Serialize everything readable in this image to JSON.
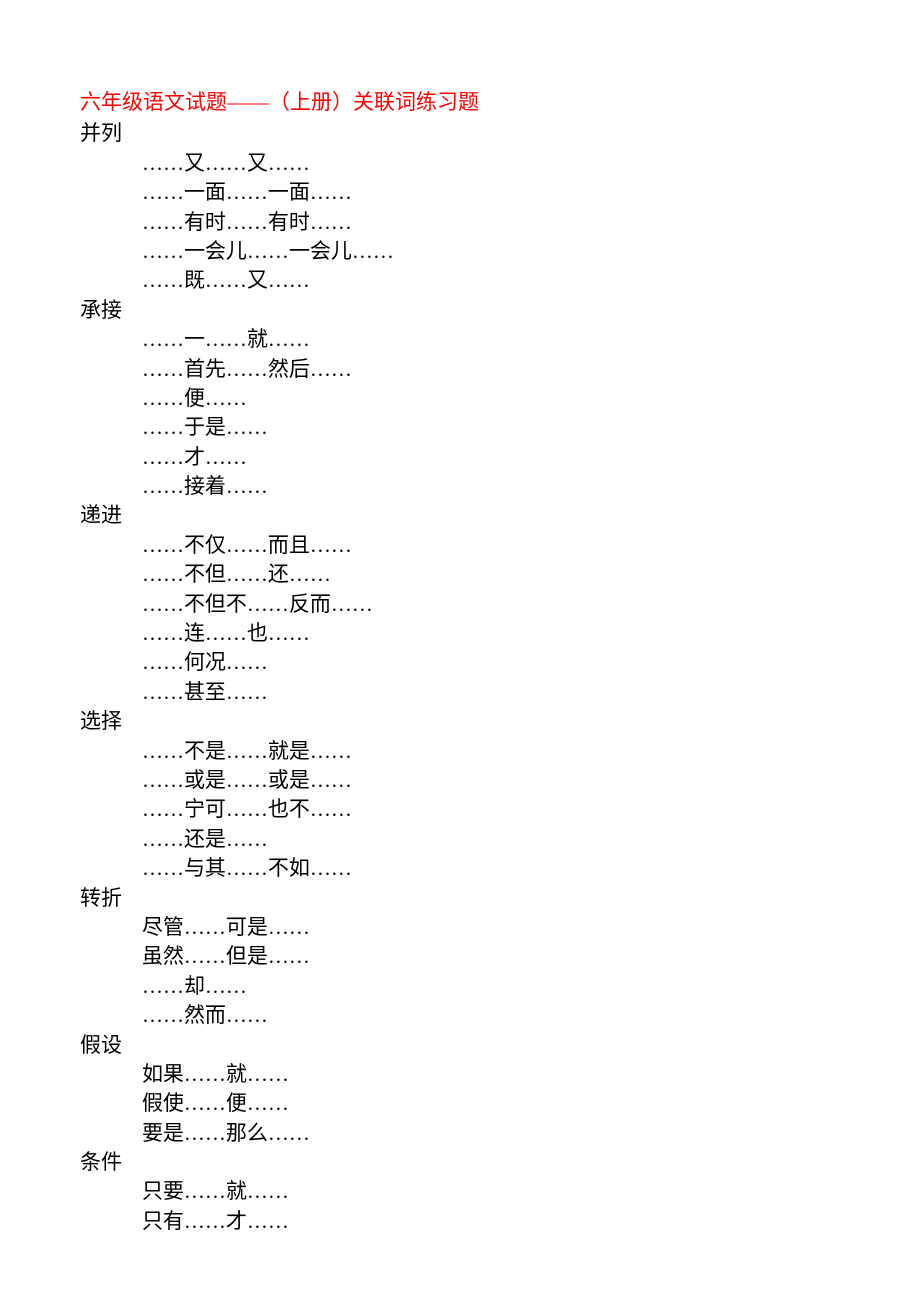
{
  "title": "六年级语文试题——（上册）关联词练习题",
  "dots": "……",
  "sections": [
    {
      "name": "并列",
      "items": [
        [
          "……",
          "又",
          "……",
          "又",
          "……"
        ],
        [
          "……",
          "一面",
          "……",
          "一面",
          "……"
        ],
        [
          "……",
          "有时",
          "……",
          "有时",
          "……"
        ],
        [
          "……",
          "一会儿",
          "……",
          "一会儿",
          "……"
        ],
        [
          "……",
          "既",
          "……",
          "又",
          "……"
        ]
      ]
    },
    {
      "name": "承接",
      "items": [
        [
          "……",
          "一",
          "……",
          "就",
          "……"
        ],
        [
          "……",
          "首先",
          "……",
          "然后",
          "……"
        ],
        [
          "……",
          "便",
          "……"
        ],
        [
          "……",
          "于是",
          "……"
        ],
        [
          "……",
          "才",
          "……"
        ],
        [
          "……",
          "接着",
          "……"
        ]
      ]
    },
    {
      "name": "递进",
      "items": [
        [
          "……",
          "不仅",
          "……",
          "而且",
          "……"
        ],
        [
          "……",
          "不但",
          "……",
          "还",
          "……"
        ],
        [
          "……",
          "不但不",
          "……",
          "反而",
          "……"
        ],
        [
          "……",
          "连",
          "……",
          "也",
          "……"
        ],
        [
          "……",
          "何况",
          "……"
        ],
        [
          "……",
          "甚至",
          "……"
        ]
      ]
    },
    {
      "name": "选择",
      "items": [
        [
          "……",
          "不是",
          "……",
          "就是",
          "……"
        ],
        [
          "……",
          "或是",
          "……",
          "或是",
          "……"
        ],
        [
          "……",
          "宁可",
          "……",
          "也不",
          "……"
        ],
        [
          "……",
          "还是",
          "……"
        ],
        [
          "……",
          "与其",
          "……",
          "不如",
          "……"
        ]
      ]
    },
    {
      "name": "转折",
      "items": [
        [
          "尽管",
          "……",
          "可是",
          "……"
        ],
        [
          "虽然",
          "……",
          "但是",
          "……"
        ],
        [
          "……",
          "却",
          "……"
        ],
        [
          "……",
          "然而",
          "……"
        ]
      ]
    },
    {
      "name": "假设",
      "items": [
        [
          "如果",
          "……",
          "就",
          "……"
        ],
        [
          "假使",
          "……",
          "便",
          "……"
        ],
        [
          "要是",
          "……",
          "那么",
          "……"
        ]
      ]
    },
    {
      "name": "条件",
      "items": [
        [
          "只要",
          "……",
          "就",
          "……"
        ],
        [
          "只有",
          "……",
          "才",
          "……"
        ]
      ]
    }
  ]
}
